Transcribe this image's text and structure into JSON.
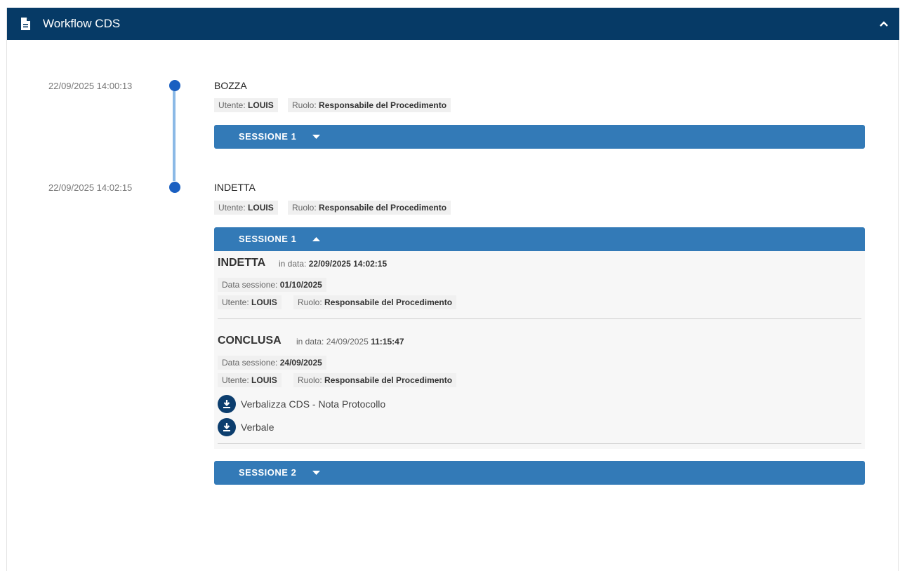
{
  "header": {
    "title": "Workflow CDS",
    "doc_icon": "document-icon",
    "collapse_icon": "chevron-up-icon"
  },
  "timeline": [
    {
      "timestamp": "22/09/2025 14:00:13",
      "state": "BOZZA",
      "user_label": "Utente:",
      "user": "LOUIS",
      "role_label": "Ruolo:",
      "role": "Responsabile del Procedimento",
      "sessions": [
        {
          "label": "SESSIONE 1",
          "expanded": false
        }
      ]
    },
    {
      "timestamp": "22/09/2025 14:02:15",
      "state": "INDETTA",
      "user_label": "Utente:",
      "user": "LOUIS",
      "role_label": "Ruolo:",
      "role": "Responsabile del Procedimento",
      "sessions": [
        {
          "label": "SESSIONE 1",
          "expanded": true,
          "events": [
            {
              "status": "INDETTA",
              "date_label": "in data:",
              "date": "22/09/2025 14:02:15",
              "session_date_label": "Data sessione:",
              "session_date": "01/10/2025",
              "user_label": "Utente:",
              "user": "LOUIS",
              "role_label": "Ruolo:",
              "role": "Responsabile del Procedimento"
            },
            {
              "status": "CONCLUSA",
              "date_label": "in data:",
              "date_day": "24/09/2025",
              "date_time": "11:15:47",
              "session_date_label": "Data sessione:",
              "session_date": "24/09/2025",
              "user_label": "Utente:",
              "user": "LOUIS",
              "role_label": "Ruolo:",
              "role": "Responsabile del Procedimento",
              "documents": [
                {
                  "label": "Verbalizza CDS - Nota Protocollo",
                  "icon": "download-icon"
                },
                {
                  "label": "Verbale",
                  "icon": "download-icon"
                }
              ]
            }
          ]
        },
        {
          "label": "SESSIONE 2",
          "expanded": false
        }
      ]
    }
  ],
  "colors": {
    "header": "#063a66",
    "session_bar": "#337ab7",
    "dot": "#1a5fc1",
    "line": "#8bb9e6",
    "download": "#0c3e6e"
  }
}
